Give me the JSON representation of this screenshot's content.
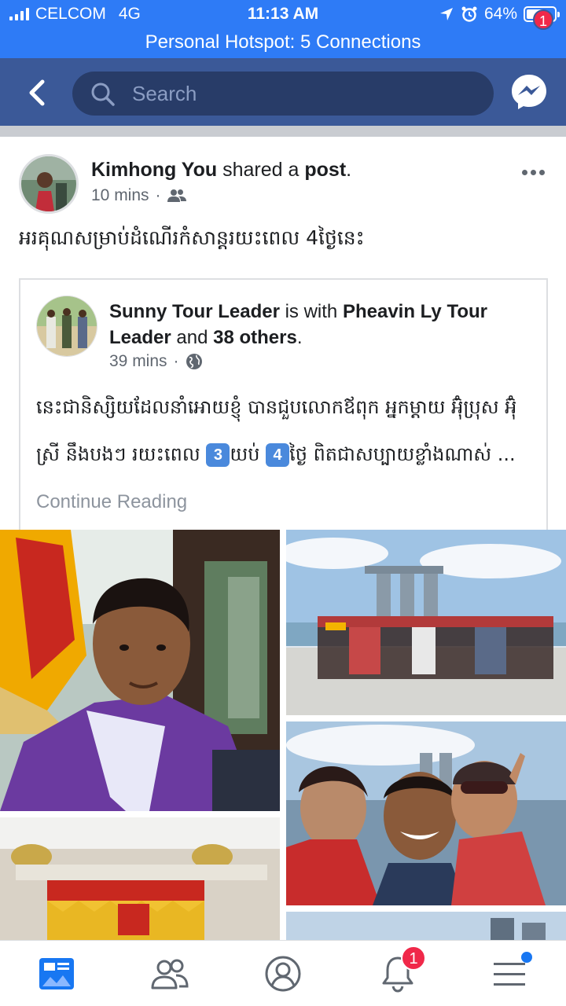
{
  "status_bar": {
    "carrier": "CELCOM",
    "network": "4G",
    "time": "11:13 AM",
    "battery": "64%",
    "battery_level": 0.64,
    "hotspot": "Personal Hotspot: 5 Connections"
  },
  "nav": {
    "search_placeholder": "Search",
    "messenger_badge": "1"
  },
  "post": {
    "author": "Kimhong You",
    "action_mid": "shared a",
    "action_object": "post",
    "action_end": ".",
    "time": "10 mins",
    "separator": "·",
    "audience_icon": "friends-icon",
    "text": "អរគុណសម្រាប់ដំណើរកំសាន្តរយះពេល 4ថ្ងៃនេះ",
    "shared": {
      "author": "Sunny Tour Leader",
      "with_text": "is with",
      "tagged": "Pheavin Ly Tour Leader",
      "and_text": "and",
      "others": "38 others",
      "end": ".",
      "time": "39 mins",
      "separator": "·",
      "audience_icon": "globe-icon",
      "text_part1": "នេះជានិស្សិយដែលនាំអោយខ្ញុំ បានជួបលោកឪពុក អ្នកម្ដាយ អ៊ុំប្រុស អ៊ុំស្រី នឹងបងៗ រយះពេល ",
      "num1": "3",
      "text_part2": "យប់ ",
      "num2": "4",
      "text_part3": "ថ្ងៃ ពិតជាសប្បាយខ្លាំងណាស់ ...",
      "continue_label": "Continue Reading"
    }
  },
  "tabs": {
    "notifications_badge": "1"
  },
  "colors": {
    "status_blue": "#2e7bf6",
    "facebook_blue": "#3b5998",
    "badge_red": "#f02849"
  }
}
